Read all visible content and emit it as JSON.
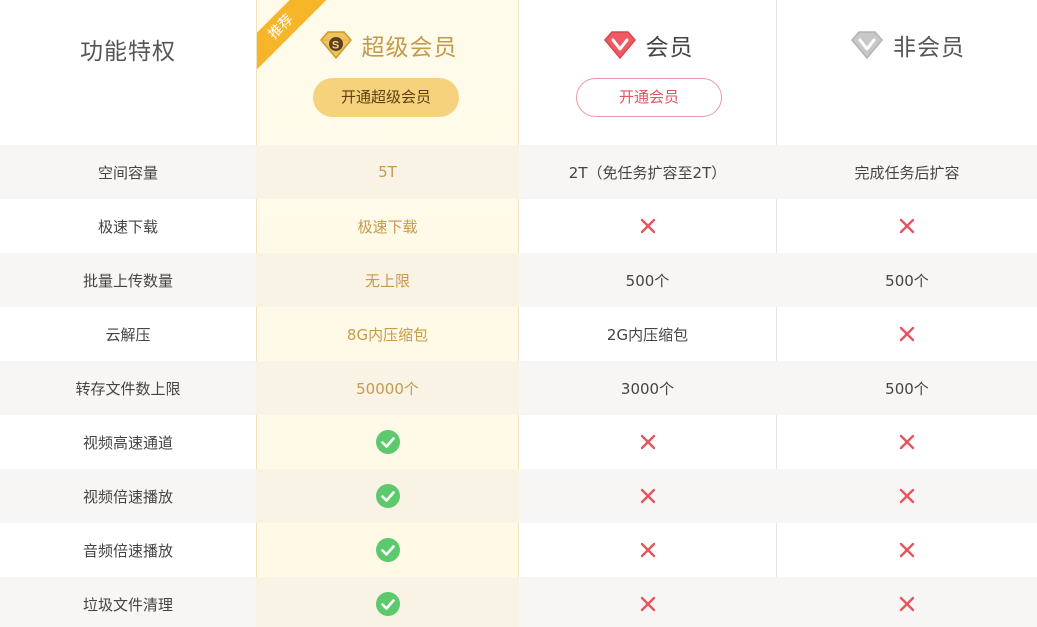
{
  "header": {
    "feature_title": "功能特权",
    "ribbon": "推荐",
    "svip": {
      "title": "超级会员",
      "button": "开通超级会员",
      "icon": "svip-diamond-icon"
    },
    "vip": {
      "title": "会员",
      "button": "开通会员",
      "icon": "vip-diamond-icon"
    },
    "free": {
      "title": "非会员",
      "icon": "free-diamond-icon"
    }
  },
  "rows": [
    {
      "feature": "空间容量",
      "svip": "5T",
      "vip": "2T（免任务扩容至2T）",
      "free": "完成任务后扩容"
    },
    {
      "feature": "极速下载",
      "svip": "极速下载",
      "vip": "cross",
      "free": "cross"
    },
    {
      "feature": "批量上传数量",
      "svip": "无上限",
      "vip": "500个",
      "free": "500个"
    },
    {
      "feature": "云解压",
      "svip": "8G内压缩包",
      "vip": "2G内压缩包",
      "free": "cross"
    },
    {
      "feature": "转存文件数上限",
      "svip": "50000个",
      "vip": "3000个",
      "free": "500个"
    },
    {
      "feature": "视频高速通道",
      "svip": "check",
      "vip": "cross",
      "free": "cross"
    },
    {
      "feature": "视频倍速播放",
      "svip": "check",
      "vip": "cross",
      "free": "cross"
    },
    {
      "feature": "音频倍速播放",
      "svip": "check",
      "vip": "cross",
      "free": "cross"
    },
    {
      "feature": "垃圾文件清理",
      "svip": "check",
      "vip": "cross",
      "free": "cross"
    }
  ],
  "colors": {
    "svip_text": "#c69a4b",
    "svip_button": "#f6d27c",
    "vip_accent": "#e0555f",
    "check": "#5cc96c",
    "cross": "#e5565e",
    "ribbon": "#f7b62a"
  }
}
